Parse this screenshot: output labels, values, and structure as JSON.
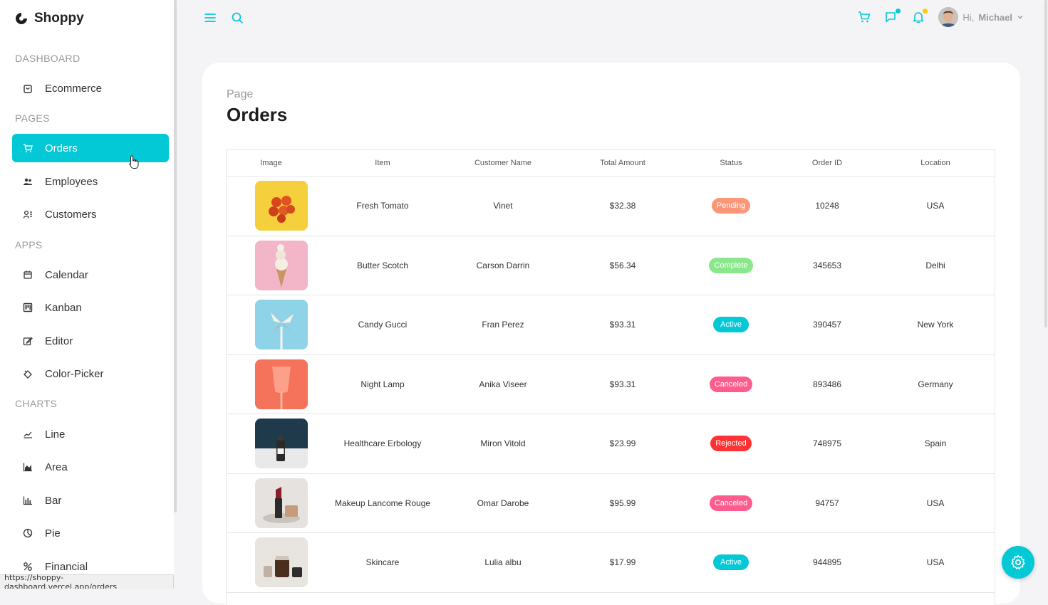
{
  "app": {
    "name": "Shoppy",
    "status_url": "https://shoppy-dashboard.vercel.app/orders"
  },
  "sidebar": {
    "sections": [
      {
        "title": "DASHBOARD",
        "items": [
          {
            "label": "Ecommerce",
            "icon": "shopping-bag-icon"
          }
        ]
      },
      {
        "title": "PAGES",
        "items": [
          {
            "label": "Orders",
            "icon": "cart-icon",
            "active": true
          },
          {
            "label": "Employees",
            "icon": "people-icon"
          },
          {
            "label": "Customers",
            "icon": "users-icon"
          }
        ]
      },
      {
        "title": "APPS",
        "items": [
          {
            "label": "Calendar",
            "icon": "calendar-icon"
          },
          {
            "label": "Kanban",
            "icon": "kanban-icon"
          },
          {
            "label": "Editor",
            "icon": "edit-icon"
          },
          {
            "label": "Color-Picker",
            "icon": "paint-bucket-icon"
          }
        ]
      },
      {
        "title": "CHARTS",
        "items": [
          {
            "label": "Line",
            "icon": "line-chart-icon"
          },
          {
            "label": "Area",
            "icon": "area-chart-icon"
          },
          {
            "label": "Bar",
            "icon": "bar-chart-icon"
          },
          {
            "label": "Pie",
            "icon": "pie-chart-icon"
          },
          {
            "label": "Financial",
            "icon": "financial-icon"
          }
        ]
      }
    ]
  },
  "topbar": {
    "greeting": "Hi,",
    "user_name": "Michael",
    "icons": [
      "menu-icon",
      "search-icon",
      "cart-icon",
      "chat-icon",
      "bell-icon"
    ]
  },
  "page": {
    "subtitle": "Page",
    "title": "Orders"
  },
  "table": {
    "headers": [
      "Image",
      "Item",
      "Customer Name",
      "Total Amount",
      "Status",
      "Order ID",
      "Location"
    ],
    "rows": [
      {
        "item": "Fresh Tomato",
        "customer": "Vinet",
        "amount": "$32.38",
        "status": "Pending",
        "order_id": "10248",
        "location": "USA",
        "image": "tomatoes"
      },
      {
        "item": "Butter Scotch",
        "customer": "Carson Darrin",
        "amount": "$56.34",
        "status": "Complete",
        "order_id": "345653",
        "location": "Delhi",
        "image": "ice-cream"
      },
      {
        "item": "Candy Gucci",
        "customer": "Fran Perez",
        "amount": "$93.31",
        "status": "Active",
        "order_id": "390457",
        "location": "New York",
        "image": "candy"
      },
      {
        "item": "Night Lamp",
        "customer": "Anika Viseer",
        "amount": "$93.31",
        "status": "Canceled",
        "order_id": "893486",
        "location": "Germany",
        "image": "lamp"
      },
      {
        "item": "Healthcare Erbology",
        "customer": "Miron Vitold",
        "amount": "$23.99",
        "status": "Rejected",
        "order_id": "748975",
        "location": "Spain",
        "image": "bottle"
      },
      {
        "item": "Makeup Lancome Rouge",
        "customer": "Omar Darobe",
        "amount": "$95.99",
        "status": "Canceled",
        "order_id": "94757",
        "location": "USA",
        "image": "lipstick"
      },
      {
        "item": "Skincare",
        "customer": "Lulia albu",
        "amount": "$17.99",
        "status": "Active",
        "order_id": "944895",
        "location": "USA",
        "image": "skincare"
      }
    ]
  },
  "colors": {
    "accent": "#03c9d7",
    "Pending": "#fb9678",
    "Complete": "#8be78b",
    "Active": "#03c9d7",
    "Canceled": "#ff5c8e",
    "Rejected": "#ff3333",
    "cart_dot": "#03c9d7",
    "bell_dot": "#fec90f"
  }
}
